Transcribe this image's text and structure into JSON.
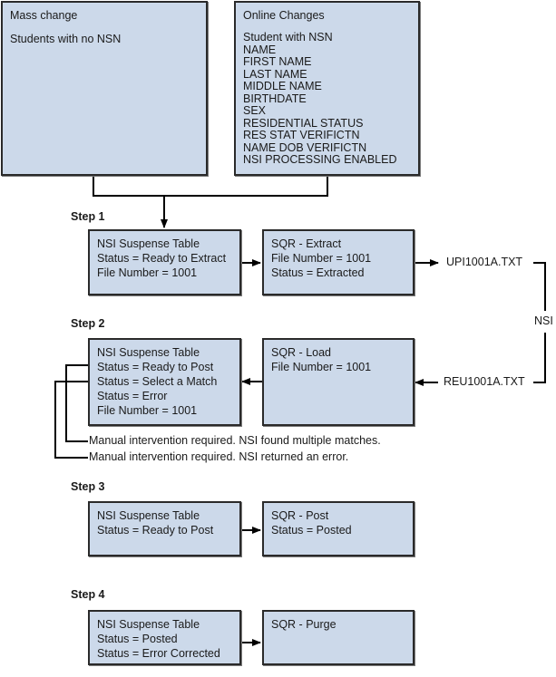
{
  "sources": {
    "mass_change": {
      "title": "Mass change",
      "lines": [
        "Students with no NSN"
      ]
    },
    "online_changes": {
      "title": "Online Changes",
      "lines": [
        "Student with NSN",
        "NAME",
        "FIRST NAME",
        "LAST NAME",
        "MIDDLE NAME",
        "BIRTHDATE",
        "SEX",
        "RESIDENTIAL STATUS",
        "RES STAT VERIFICTN",
        "NAME DOB VERIFICTN",
        "NSI PROCESSING ENABLED"
      ]
    }
  },
  "steps": [
    {
      "label": "Step 1",
      "left": [
        "NSI Suspense Table",
        "Status = Ready to Extract",
        "File Number = 1001"
      ],
      "right": [
        "SQR - Extract",
        "File Number = 1001",
        "Status = Extracted"
      ]
    },
    {
      "label": "Step 2",
      "left": [
        "NSI Suspense Table",
        "Status = Ready to Post",
        "Status = Select a Match",
        "Status = Error",
        "File Number = 1001"
      ],
      "right": [
        "SQR - Load",
        "File Number = 1001"
      ],
      "notes": [
        "Manual intervention required. NSI found multiple matches.",
        "Manual intervention required. NSI returned an error."
      ]
    },
    {
      "label": "Step 3",
      "left": [
        "NSI Suspense Table",
        "Status = Ready to Post"
      ],
      "right": [
        "SQR - Post",
        "Status = Posted"
      ]
    },
    {
      "label": "Step 4",
      "left": [
        "NSI Suspense Table",
        "Status = Posted",
        "Status = Error Corrected"
      ],
      "right": [
        "SQR - Purge"
      ]
    }
  ],
  "files": {
    "outbound": "UPI1001A.TXT",
    "inbound": "REU1001A.TXT",
    "external_system": "NSI"
  }
}
